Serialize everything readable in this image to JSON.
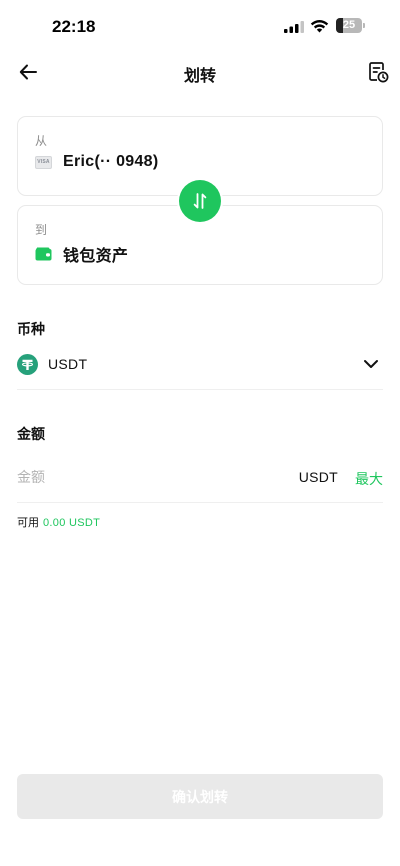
{
  "status_bar": {
    "time": "22:18",
    "battery_level": "25",
    "icons": [
      "signal-icon",
      "wifi-icon",
      "battery-icon"
    ]
  },
  "nav": {
    "title": "划转",
    "icons": [
      "back-arrow-icon",
      "transfer-history-icon"
    ]
  },
  "from": {
    "label": "从",
    "account": "Eric(·· 0948)",
    "icon": "visa-card-icon"
  },
  "to": {
    "label": "到",
    "account": "钱包资产",
    "icon": "wallet-icon"
  },
  "swap": {
    "icon": "swap-arrows-icon"
  },
  "coin": {
    "heading": "币种",
    "selected": "USDT",
    "icon": "tether-icon"
  },
  "amount": {
    "heading": "金额",
    "placeholder": "金额",
    "value": "",
    "unit": "USDT",
    "max_label": "最大"
  },
  "available": {
    "label": "可用",
    "value": "0.00 USDT"
  },
  "confirm": {
    "label": "确认划转"
  },
  "colors": {
    "accent": "#1fc65e",
    "tether": "#26a17b",
    "disabled_button": "#e9e9e9"
  }
}
